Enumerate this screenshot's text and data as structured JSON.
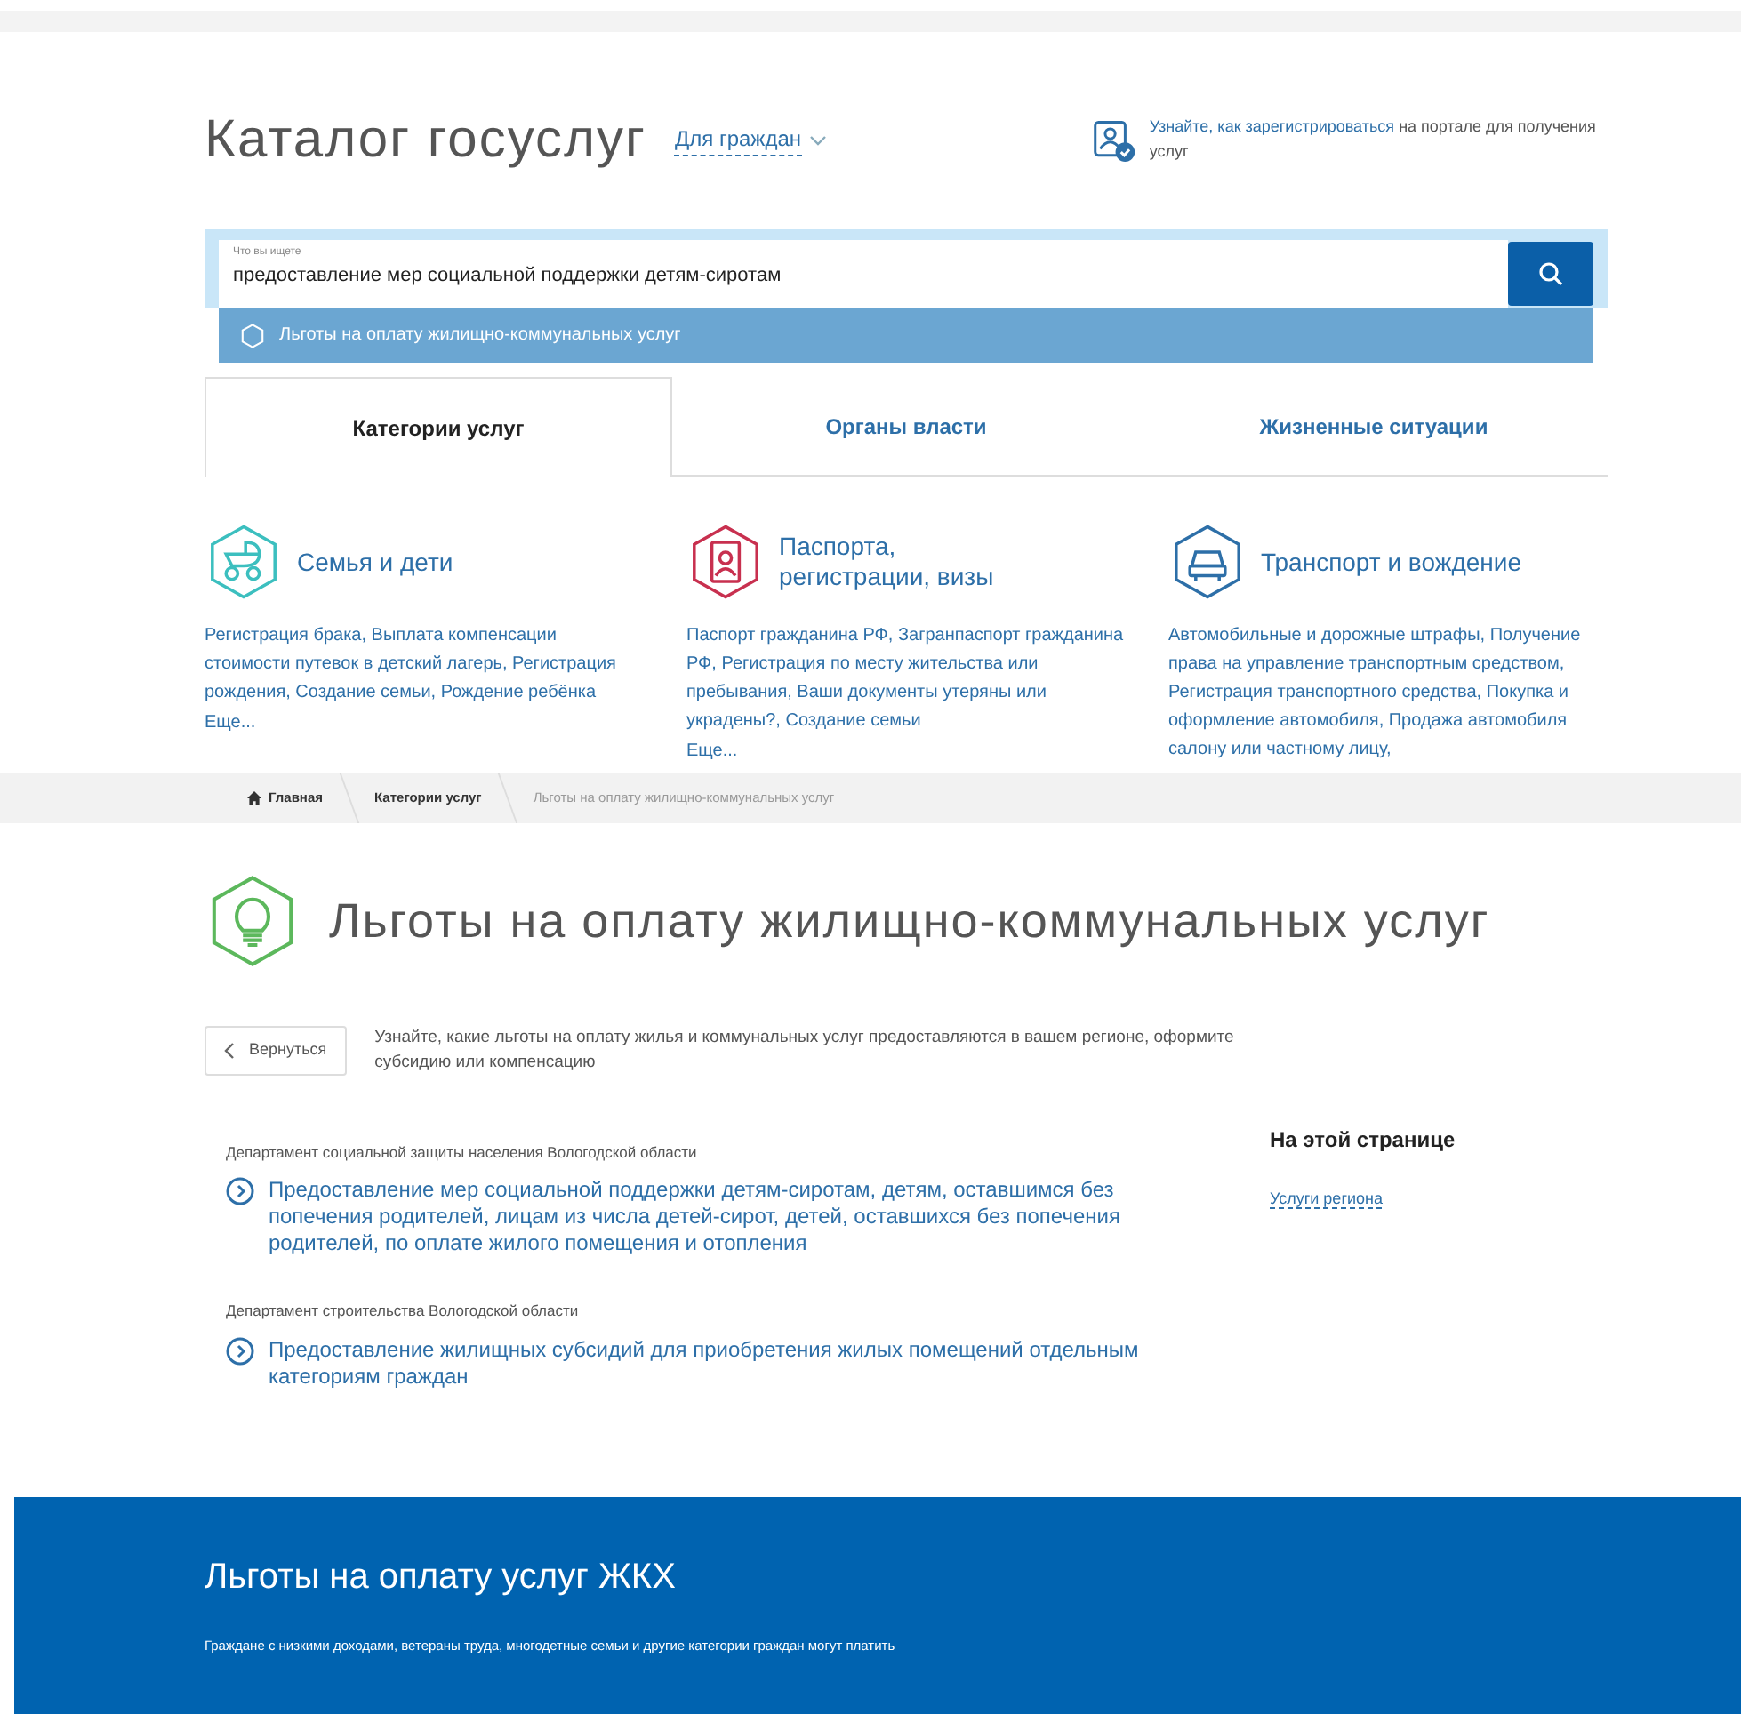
{
  "header": {
    "title": "Каталог госуслуг",
    "audience": "Для граждан",
    "register_link": "Узнайте, как зарегистрироваться",
    "register_text": "на портале для получения услуг"
  },
  "search": {
    "label": "Что вы ищете",
    "value": "предоставление мер социальной поддержки детям-сиротам",
    "suggestion": "Льготы на оплату жилищно-коммунальных услуг"
  },
  "tabs": [
    {
      "label": "Категории услуг",
      "selected": true
    },
    {
      "label": "Органы власти",
      "selected": false
    },
    {
      "label": "Жизненные ситуации",
      "selected": false
    }
  ],
  "categories": [
    {
      "kind": "family",
      "color": "#3cbfbf",
      "title": "Семья и дети",
      "links": "Регистрация брака, Выплата компенсации стоимости путевок в детский лагерь, Регистрация рождения, Создание семьи, Рождение ребёнка",
      "more": "Еще..."
    },
    {
      "kind": "passport",
      "color": "#c8304f",
      "title": "Паспорта, регистрации, визы",
      "links": "Паспорт гражданина РФ, Загранпаспорт гражданина РФ, Регистрация по месту жительства или пребывания, Ваши документы утеряны или украдены?, Создание семьи",
      "more": "Еще..."
    },
    {
      "kind": "transport",
      "color": "#2d6fa8",
      "title": "Транспорт и вождение",
      "links": "Автомобильные и дорожные штрафы, Получение права на управление транспортным средством, Регистрация транспортного средства, Покупка и оформление автомобиля, Продажа автомобиля салону или частному лицу,"
    }
  ],
  "breadcrumb": [
    {
      "label": "Главная",
      "current": false,
      "kind": "home"
    },
    {
      "label": "Категории услуг",
      "current": false
    },
    {
      "label": "Льготы на оплату жилищно-коммунальных услуг",
      "current": true
    }
  ],
  "page_title": "Льготы на оплату жилищно-коммунальных услуг",
  "back_button": "Вернуться",
  "intro": "Узнайте, какие льготы на оплату жилья и коммунальных услуг предоставляются в вашем регионе, оформите субсидию или компенсацию",
  "departments": [
    {
      "name": "Департамент социальной защиты населения Вологодской области",
      "services": [
        "Предоставление мер социальной поддержки детям-сиротам, детям, оставшимся без попечения родителей, лицам из числа детей-сирот, детей, оставшихся без попечения родителей, по оплате жилого помещения и отопления"
      ]
    },
    {
      "name": "Департамент строительства Вологодской области",
      "services": [
        "Предоставление жилищных субсидий для приобретения жилых помещений отдельным категориям граждан"
      ]
    }
  ],
  "on_this_page": {
    "title": "На этой странице",
    "links": [
      "Услуги региона"
    ]
  },
  "banner": {
    "title": "Льготы на оплату услуг ЖКХ",
    "text": "Граждане с низкими доходами, ветераны труда, многодетные семьи и другие категории граждан могут платить"
  }
}
